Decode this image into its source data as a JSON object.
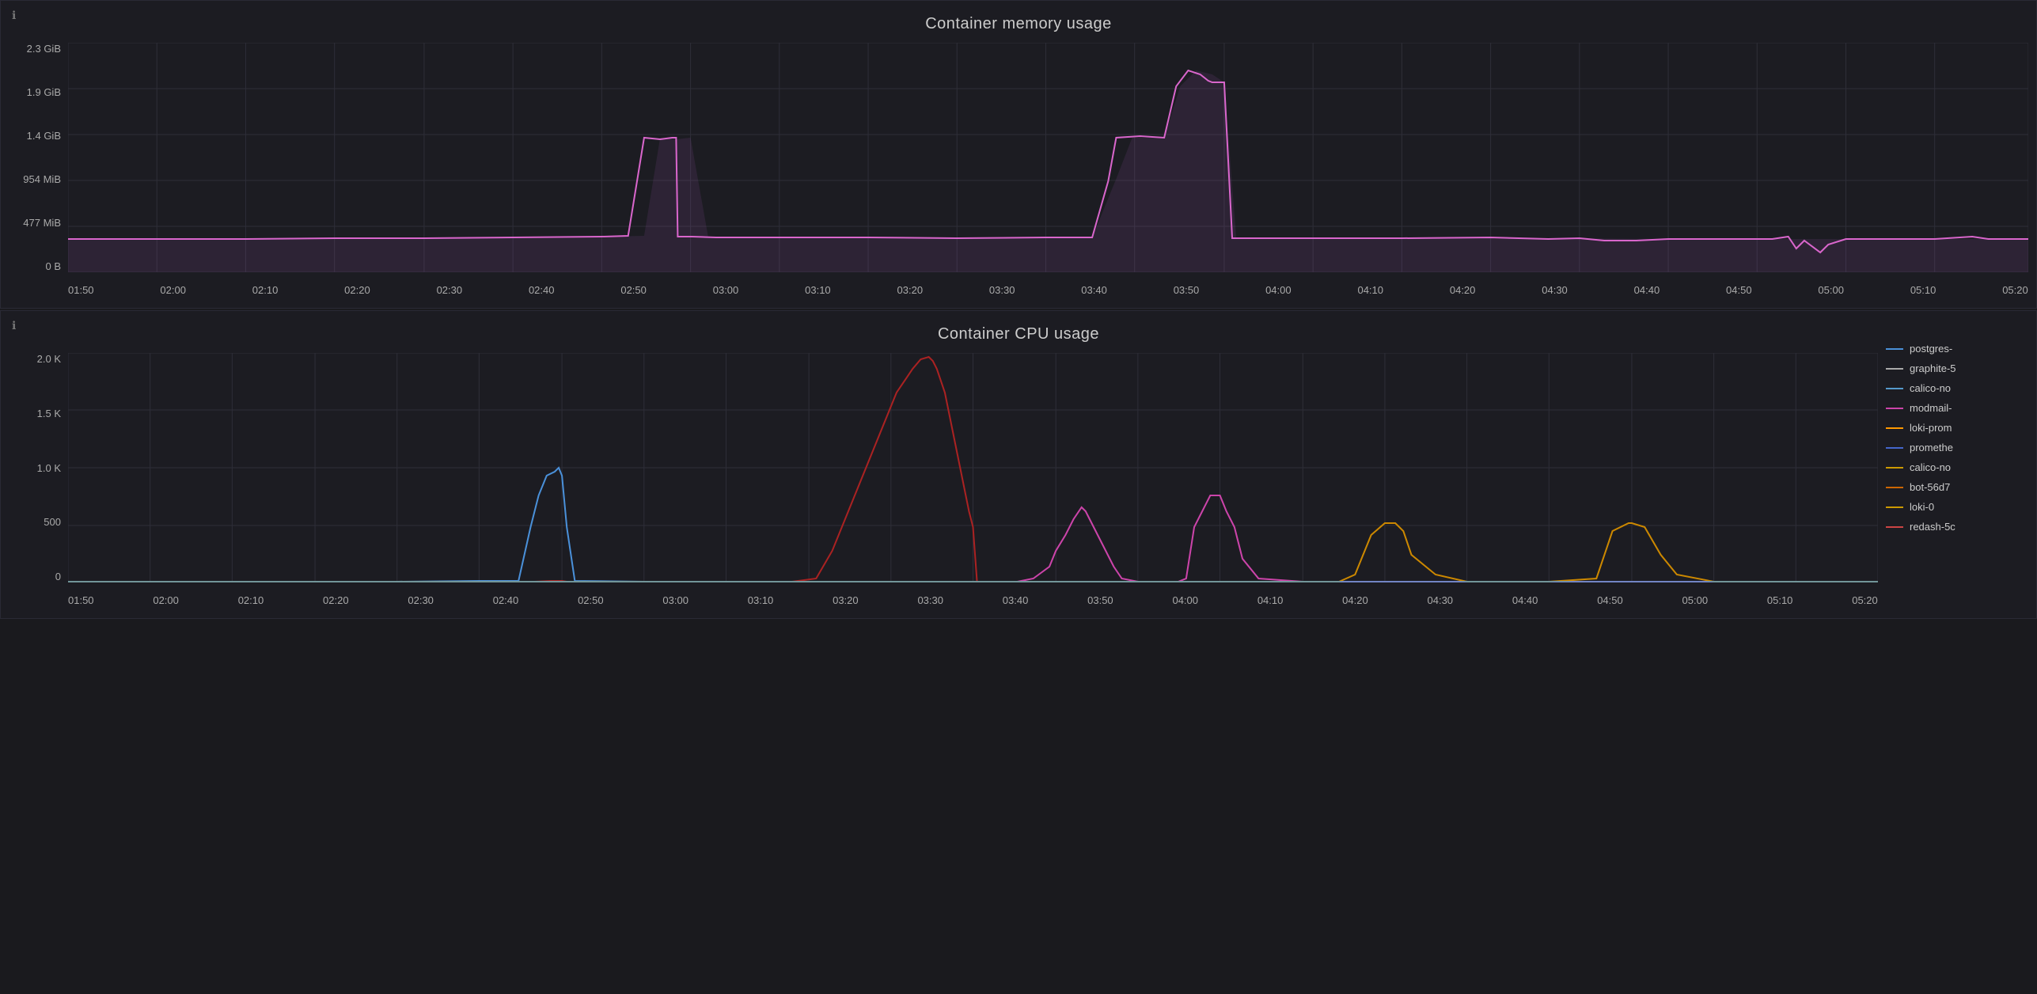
{
  "memory_panel": {
    "title": "Container memory usage",
    "info_icon": "ℹ",
    "y_labels": [
      "2.3 GiB",
      "1.9 GiB",
      "1.4 GiB",
      "954 MiB",
      "477 MiB",
      "0 B"
    ],
    "x_labels": [
      "01:50",
      "02:00",
      "02:10",
      "02:20",
      "02:30",
      "02:40",
      "02:50",
      "03:00",
      "03:10",
      "03:20",
      "03:30",
      "03:40",
      "03:50",
      "04:00",
      "04:10",
      "04:20",
      "04:30",
      "04:40",
      "04:50",
      "05:00",
      "05:10",
      "05:20"
    ],
    "line_color": "#d966cc",
    "shaded_color": "rgba(180,100,200,0.15)"
  },
  "cpu_panel": {
    "title": "Container CPU usage",
    "info_icon": "ℹ",
    "y_labels": [
      "2.0 K",
      "1.5 K",
      "1.0 K",
      "500",
      "0"
    ],
    "x_labels": [
      "01:50",
      "02:00",
      "02:10",
      "02:20",
      "02:30",
      "02:40",
      "02:50",
      "03:00",
      "03:10",
      "03:20",
      "03:30",
      "03:40",
      "03:50",
      "04:00",
      "04:10",
      "04:20",
      "04:30",
      "04:40",
      "04:50",
      "05:00",
      "05:10",
      "05:20"
    ],
    "legend": [
      {
        "label": "postgres-",
        "color": "#4a90d9"
      },
      {
        "label": "graphite-5",
        "color": "#aaaaaa"
      },
      {
        "label": "calico-no",
        "color": "#5599cc"
      },
      {
        "label": "modmail-",
        "color": "#cc44aa"
      },
      {
        "label": "loki-prom",
        "color": "#ff9900"
      },
      {
        "label": "promethe",
        "color": "#4466cc"
      },
      {
        "label": "calico-no",
        "color": "#cc9900"
      },
      {
        "label": "bot-56d7",
        "color": "#cc6600"
      },
      {
        "label": "loki-0",
        "color": "#cc9900"
      },
      {
        "label": "redash-5c",
        "color": "#cc4444"
      }
    ]
  }
}
